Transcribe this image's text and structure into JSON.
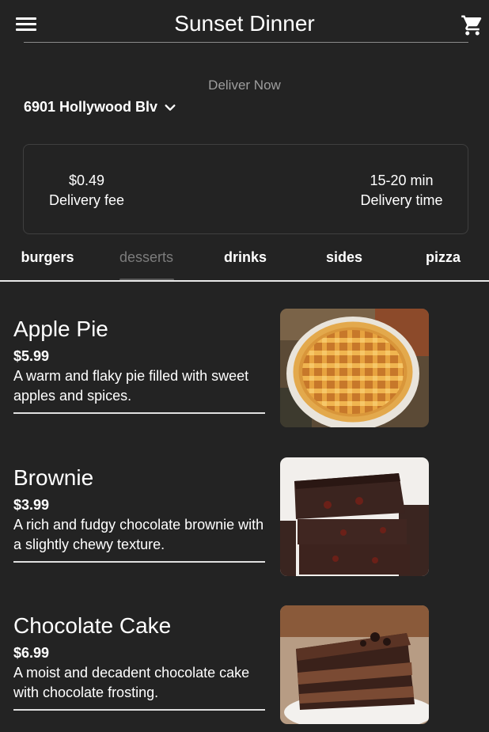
{
  "header": {
    "title": "Sunset Dinner",
    "menu_icon": "menu-icon",
    "cart_icon": "cart-icon"
  },
  "delivery": {
    "label": "Deliver Now",
    "address": "6901 Hollywood Blv",
    "fee_value": "$0.49",
    "fee_label": "Delivery fee",
    "time_value": "15-20 min",
    "time_label": "Delivery time"
  },
  "tabs": [
    {
      "label": "burgers"
    },
    {
      "label": "desserts"
    },
    {
      "label": "drinks"
    },
    {
      "label": "sides"
    },
    {
      "label": "pizza"
    }
  ],
  "selected_tab": "desserts",
  "items": [
    {
      "name": "Apple Pie",
      "price": "$5.99",
      "description": "A warm and flaky pie filled with sweet apples and spices."
    },
    {
      "name": "Brownie",
      "price": "$3.99",
      "description": "A rich and fudgy chocolate brownie with a slightly chewy texture."
    },
    {
      "name": "Chocolate Cake",
      "price": "$6.99",
      "description": "A moist and decadent chocolate cake with chocolate frosting."
    }
  ],
  "colors": {
    "background": "#232323",
    "text": "#ffffff",
    "muted": "#9e9e9e"
  }
}
